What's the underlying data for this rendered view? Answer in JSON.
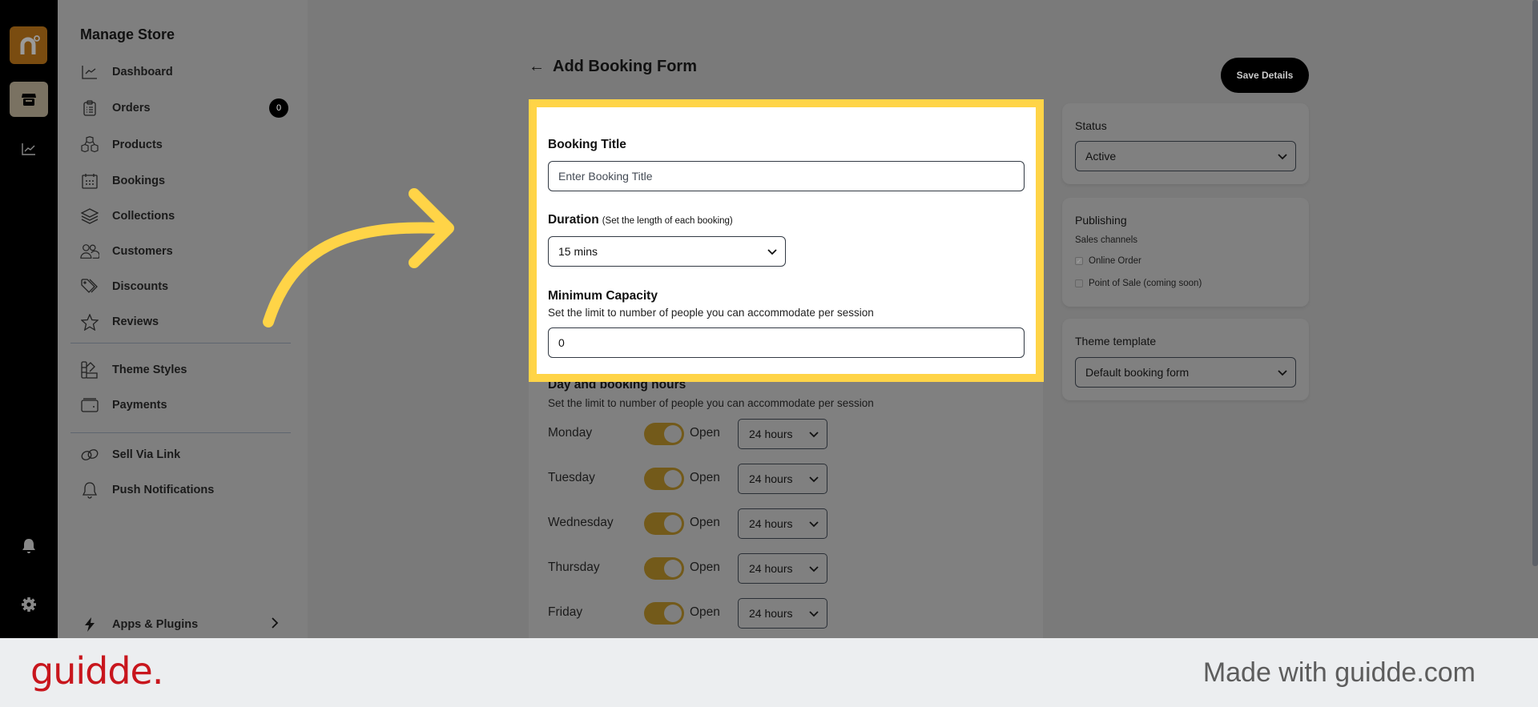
{
  "rail": {
    "icons": [
      "brand-logo-icon",
      "store-icon",
      "analytics-icon",
      "bell-icon",
      "gear-icon"
    ],
    "brand_letter": "n"
  },
  "sidebar": {
    "title": "Manage Store",
    "items": [
      {
        "label": "Dashboard",
        "icon": "chart-line-icon"
      },
      {
        "label": "Orders",
        "icon": "clipboard-icon",
        "badge": "0"
      },
      {
        "label": "Products",
        "icon": "boxes-icon"
      },
      {
        "label": "Bookings",
        "icon": "calendar-icon"
      },
      {
        "label": "Collections",
        "icon": "layers-icon"
      },
      {
        "label": "Customers",
        "icon": "users-icon"
      },
      {
        "label": "Discounts",
        "icon": "tag-icon"
      },
      {
        "label": "Reviews",
        "icon": "star-icon"
      }
    ],
    "items2": [
      {
        "label": "Theme Styles",
        "icon": "palette-icon"
      },
      {
        "label": "Payments",
        "icon": "wallet-icon"
      }
    ],
    "items3": [
      {
        "label": "Sell Via Link",
        "icon": "link-icon"
      },
      {
        "label": "Push Notifications",
        "icon": "bell-icon"
      }
    ],
    "apps": {
      "label": "Apps & Plugins",
      "icon": "bolt-icon"
    }
  },
  "header": {
    "title": "Add Booking Form",
    "save_label": "Save Details"
  },
  "form": {
    "booking_title": {
      "label": "Booking Title",
      "placeholder": "Enter Booking Title",
      "value": ""
    },
    "duration": {
      "label": "Duration",
      "hint": "(Set the length of each booking)",
      "value": "15 mins"
    },
    "min_capacity": {
      "label": "Minimum Capacity",
      "sub": "Set the limit to number of people you can accommodate per session",
      "value": "0"
    },
    "day_hours": {
      "title": "Day and booking hours",
      "sub": "Set the limit to number of people you can accommodate per session",
      "days": [
        {
          "day": "Monday",
          "open": true,
          "status": "Open",
          "hours": "24 hours"
        },
        {
          "day": "Tuesday",
          "open": true,
          "status": "Open",
          "hours": "24 hours"
        },
        {
          "day": "Wednesday",
          "open": true,
          "status": "Open",
          "hours": "24 hours"
        },
        {
          "day": "Thursday",
          "open": true,
          "status": "Open",
          "hours": "24 hours"
        },
        {
          "day": "Friday",
          "open": true,
          "status": "Open",
          "hours": "24 hours"
        }
      ]
    }
  },
  "right": {
    "status": {
      "label": "Status",
      "value": "Active"
    },
    "publishing": {
      "title": "Publishing",
      "sub": "Sales channels",
      "channels": [
        {
          "label": "Online Order",
          "checked": true
        },
        {
          "label": "Point of Sale (coming soon)",
          "checked": false
        }
      ]
    },
    "theme": {
      "label": "Theme template",
      "value": "Default booking form"
    }
  },
  "colors": {
    "highlight": "#ffd447",
    "overlay": "#7a7a7a",
    "toggle_on": "#735a1a",
    "brand": "#7a4c10"
  },
  "footer": {
    "logo": "guidde.",
    "tagline": "Made with guidde.com"
  }
}
